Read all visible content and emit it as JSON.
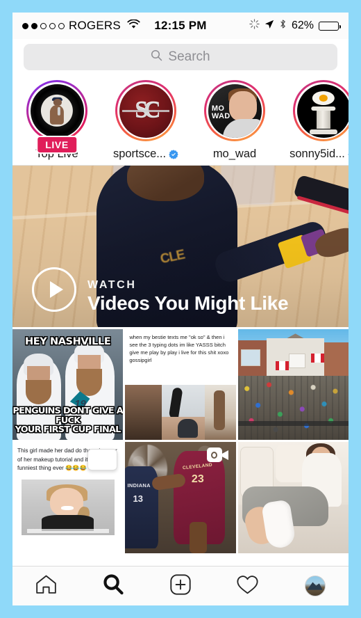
{
  "theme": {
    "page_border_color": "#8fd9f9",
    "app_background": "#ffffff",
    "search_field_bg": "#e9e9ea",
    "verified_blue": "#3897f0",
    "live_badge_bg": "#e01e5a",
    "text_primary": "#1a1a1a",
    "text_placeholder": "#8e8e93"
  },
  "status_bar": {
    "carrier": "ROGERS",
    "signal_dots_filled": 2,
    "signal_dots_total": 5,
    "wifi_icon": "wifi-icon",
    "time": "12:15 PM",
    "right_icons": [
      "loading-spinner-icon",
      "location-arrow-icon",
      "bluetooth-icon"
    ],
    "battery_percent": "62%",
    "battery_level": 62
  },
  "search": {
    "icon": "search-icon",
    "placeholder": "Search",
    "value": ""
  },
  "stories": {
    "items": [
      {
        "name": "Top Live",
        "ring": "live",
        "live_badge": "LIVE",
        "verified": false,
        "avatar": "person-with-microphone-avatar"
      },
      {
        "name": "sportsce...",
        "ring": "gradient",
        "live_badge": "",
        "verified": true,
        "avatar": "sportscenter-sc-logo-avatar"
      },
      {
        "name": "mo_wad",
        "ring": "gradient",
        "live_badge": "",
        "verified": false,
        "avatar": "mo-wad-portrait-avatar",
        "overlay_text": "MO\nWAD"
      },
      {
        "name": "sonny5id...",
        "ring": "gradient",
        "live_badge": "",
        "verified": true,
        "avatar": "egg-on-pillar-avatar"
      }
    ]
  },
  "hero": {
    "kicker": "WATCH",
    "title": "Videos You Might Like",
    "play_icon": "play-circle-icon",
    "image_description": "basketball-player-on-court"
  },
  "grid": {
    "posts": [
      {
        "id": "post-hockey-meme",
        "type": "image",
        "top_caption": "HEY NASHVILLE",
        "bottom_caption_line1": "PENGUINS DONT GIVE A FUCK",
        "bottom_caption_line2": "YOUR FIRST CUP FINAL",
        "jersey_number": "19"
      },
      {
        "id": "post-gossipgirl-text",
        "type": "image",
        "text": "when my bestie texts me \"ok so\" & then i see the 3 typing dots im like YASSS bitch give me play by play i live for this shit xoxo gossipgirl"
      },
      {
        "id": "post-toy-house",
        "type": "image",
        "description": "house-covered-in-toys-with-canadian-flags"
      },
      {
        "id": "post-makeup-tutorial-tweet",
        "type": "image",
        "text": "This girl made her dad do the voiceover of her makeup tutorial and it's the funniest thing ever 😂😂😂"
      },
      {
        "id": "post-basketball-video",
        "type": "video",
        "badge_icon": "video-camera-icon",
        "team_text": "CLEVELAND",
        "player_number": "23",
        "opponent_text": "INDIANA",
        "opponent_number": "13"
      },
      {
        "id": "post-leg-cast",
        "type": "image",
        "description": "woman-on-couch-with-leg-cast"
      }
    ]
  },
  "tabbar": {
    "items": [
      {
        "name": "home-tab",
        "icon": "home-icon",
        "active": false
      },
      {
        "name": "search-tab",
        "icon": "search-icon",
        "active": true
      },
      {
        "name": "add-post-tab",
        "icon": "plus-square-icon",
        "active": false
      },
      {
        "name": "activity-tab",
        "icon": "heart-icon",
        "active": false
      },
      {
        "name": "profile-tab",
        "icon": "profile-avatar-icon",
        "active": false
      }
    ]
  }
}
